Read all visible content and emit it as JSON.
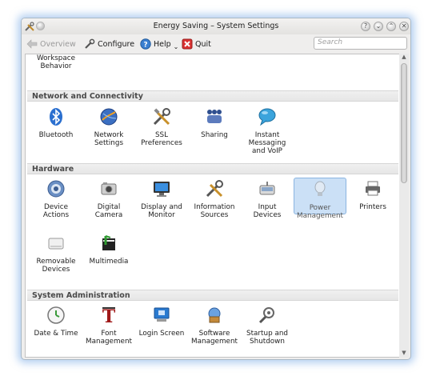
{
  "window": {
    "title": "Energy Saving – System Settings",
    "title_buttons": [
      "?",
      "⌄",
      "⌃",
      "✕"
    ]
  },
  "toolbar": {
    "overview_label": "Overview",
    "configure_label": "Configure",
    "help_label": "Help",
    "quit_label": "Quit",
    "search_placeholder": "Search"
  },
  "top_partial": {
    "label_line1": "Workspace",
    "label_line2": "Behavior"
  },
  "sections": [
    {
      "title": "Network and Connectivity",
      "items": [
        {
          "label": "Bluetooth",
          "icon": "bluetooth-icon"
        },
        {
          "label": "Network\nSettings",
          "icon": "network-globe-icon"
        },
        {
          "label": "SSL\nPreferences",
          "icon": "tools-icon"
        },
        {
          "label": "Sharing",
          "icon": "sharing-icon"
        },
        {
          "label": "Instant\nMessaging\nand VoIP",
          "icon": "chat-bubble-icon"
        }
      ]
    },
    {
      "title": "Hardware",
      "items": [
        {
          "label": "Device\nActions",
          "icon": "gear-device-icon"
        },
        {
          "label": "Digital\nCamera",
          "icon": "camera-icon"
        },
        {
          "label": "Display and\nMonitor",
          "icon": "monitor-icon"
        },
        {
          "label": "Information\nSources",
          "icon": "tools-icon"
        },
        {
          "label": "Input\nDevices",
          "icon": "input-device-icon"
        },
        {
          "label": "Power\nManagement",
          "icon": "power-bulb-icon"
        },
        {
          "label": "Printers",
          "icon": "printer-icon"
        },
        {
          "label": "Removable\nDevices",
          "icon": "drive-icon"
        },
        {
          "label": "Multimedia",
          "icon": "multimedia-icon"
        }
      ]
    },
    {
      "title": "System Administration",
      "items": [
        {
          "label": "Date & Time",
          "icon": "clock-icon"
        },
        {
          "label": "Font\nManagement",
          "icon": "font-icon"
        },
        {
          "label": "Login Screen",
          "icon": "login-monitor-icon"
        },
        {
          "label": "Software\nManagement",
          "icon": "software-package-icon"
        },
        {
          "label": "Startup and\nShutdown",
          "icon": "startup-gear-icon"
        }
      ]
    }
  ],
  "colors": {
    "selection": "#cbe0f6",
    "glow": "#78aae6"
  }
}
